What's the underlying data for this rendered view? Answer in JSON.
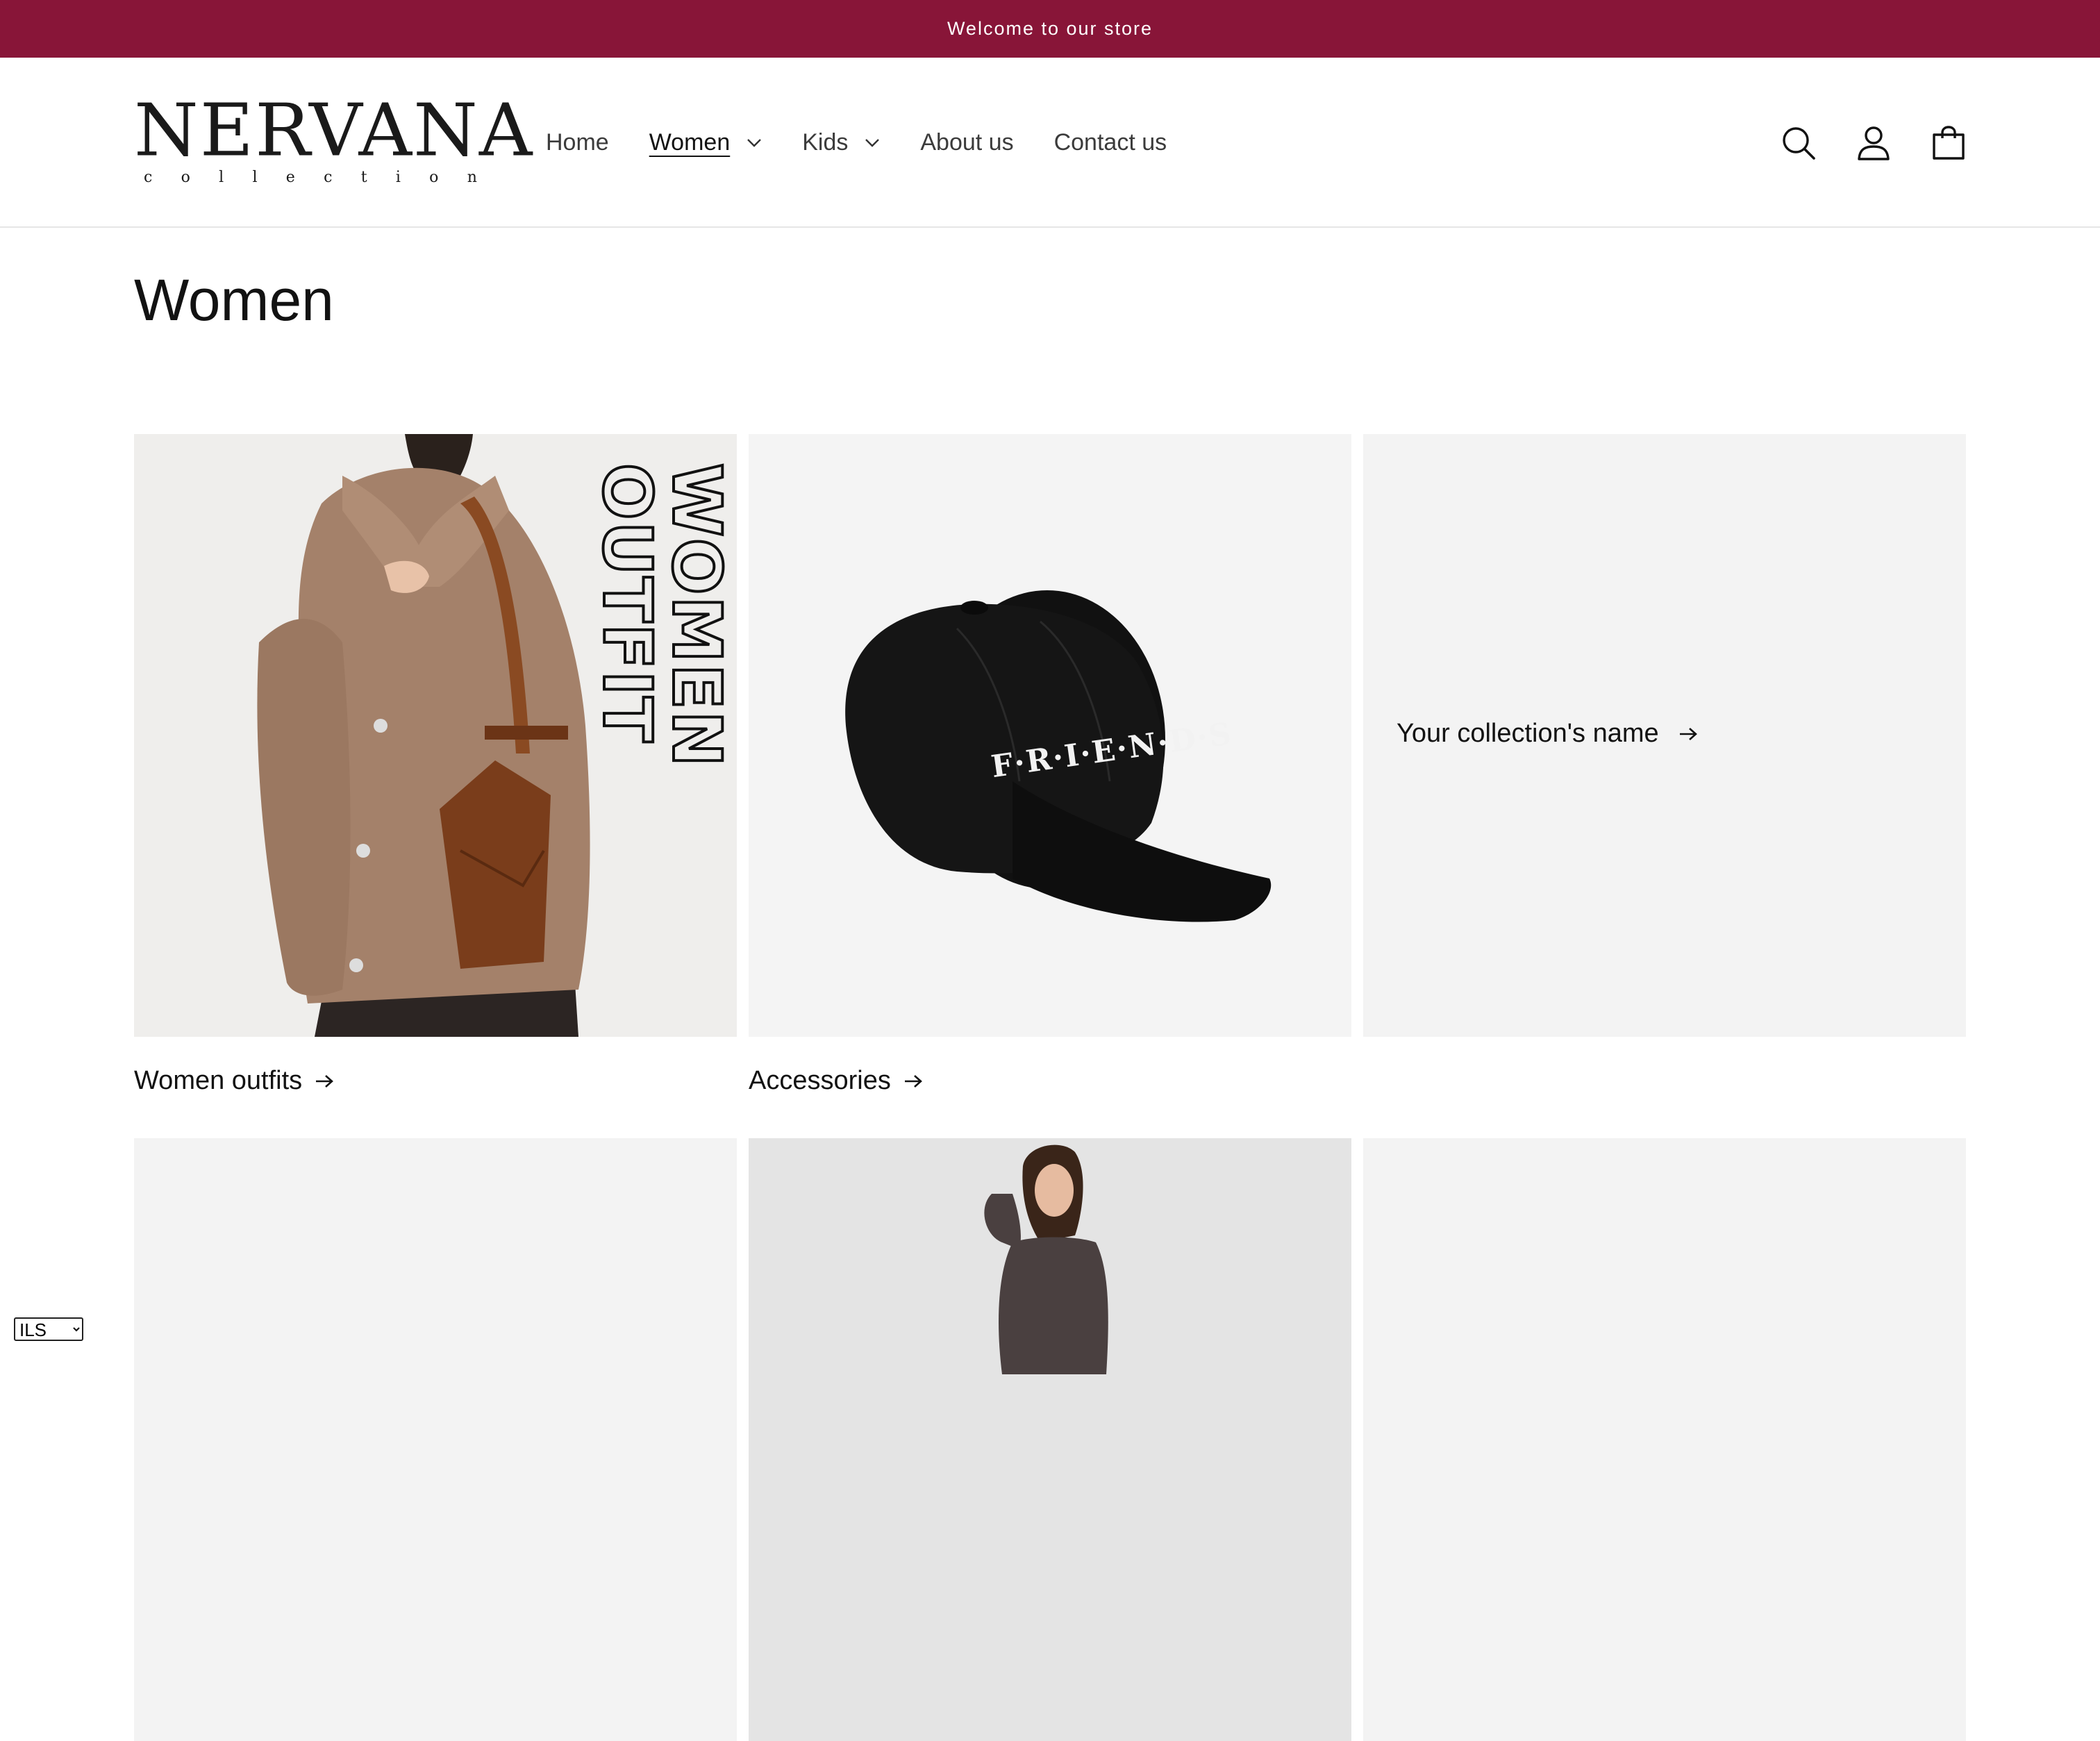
{
  "announcement": "Welcome to our store",
  "logo": {
    "main": "NERVANA",
    "sub": [
      "c",
      "o",
      "l",
      "l",
      "e",
      "c",
      "t",
      "i",
      "o",
      "n"
    ]
  },
  "nav": [
    {
      "label": "Home",
      "dropdown": false,
      "active": false
    },
    {
      "label": "Women",
      "dropdown": true,
      "active": true
    },
    {
      "label": "Kids",
      "dropdown": true,
      "active": false
    },
    {
      "label": "About us",
      "dropdown": false,
      "active": false
    },
    {
      "label": "Contact us",
      "dropdown": false,
      "active": false
    }
  ],
  "header_icons": [
    "search-icon",
    "account-icon",
    "cart-icon"
  ],
  "page_title": "Women",
  "collections": [
    {
      "title": "Women outfits",
      "image_text": "WOMEN OUTFIT"
    },
    {
      "title": "Accessories",
      "image_text": "F·R·I·E·N·D·S"
    },
    {
      "title": "Your collection's name"
    }
  ],
  "currency": {
    "selected": "ILS"
  },
  "colors": {
    "announcement_bg": "#881538",
    "placeholder_bg": "#f3f3f3"
  }
}
